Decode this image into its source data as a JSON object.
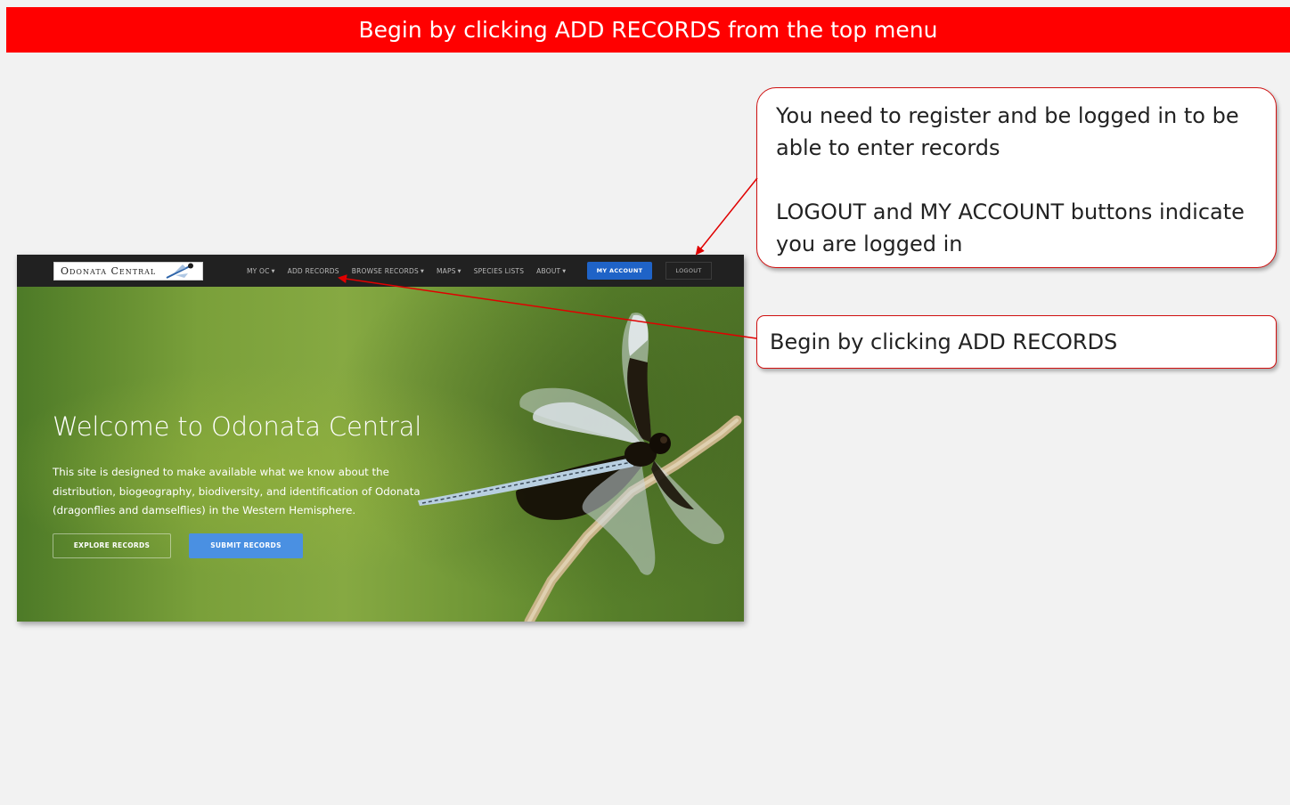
{
  "slide": {
    "title": "Begin by clicking ADD RECORDS from the top menu"
  },
  "site": {
    "logo_text": "Odonata Central",
    "nav": [
      {
        "label": "MY OC",
        "has_dropdown": true
      },
      {
        "label": "ADD RECORDS",
        "has_dropdown": false
      },
      {
        "label": "BROWSE RECORDS",
        "has_dropdown": true
      },
      {
        "label": "MAPS",
        "has_dropdown": true
      },
      {
        "label": "SPECIES LISTS",
        "has_dropdown": false
      },
      {
        "label": "ABOUT",
        "has_dropdown": true
      }
    ],
    "my_account_label": "MY ACCOUNT",
    "logout_label": "LOGOUT",
    "hero": {
      "title": "Welcome to Odonata Central",
      "description": "This site is designed to make available what we know about the distribution, biogeography, biodiversity, and identification of Odonata (dragonflies and damselflies) in the Western Hemisphere.",
      "explore_label": "EXPLORE RECORDS",
      "submit_label": "SUBMIT RECORDS"
    }
  },
  "callouts": {
    "login_line1": "You need to register and be logged in to be able to enter records",
    "login_line2": "LOGOUT and MY ACCOUNT buttons indicate you are logged in",
    "add_records": "Begin by clicking ADD RECORDS"
  },
  "colors": {
    "banner": "#ff0000",
    "callout_border": "#d01010",
    "nav_bg": "#212121",
    "my_account_bg": "#1f63c7",
    "submit_bg": "#4a90e2"
  }
}
